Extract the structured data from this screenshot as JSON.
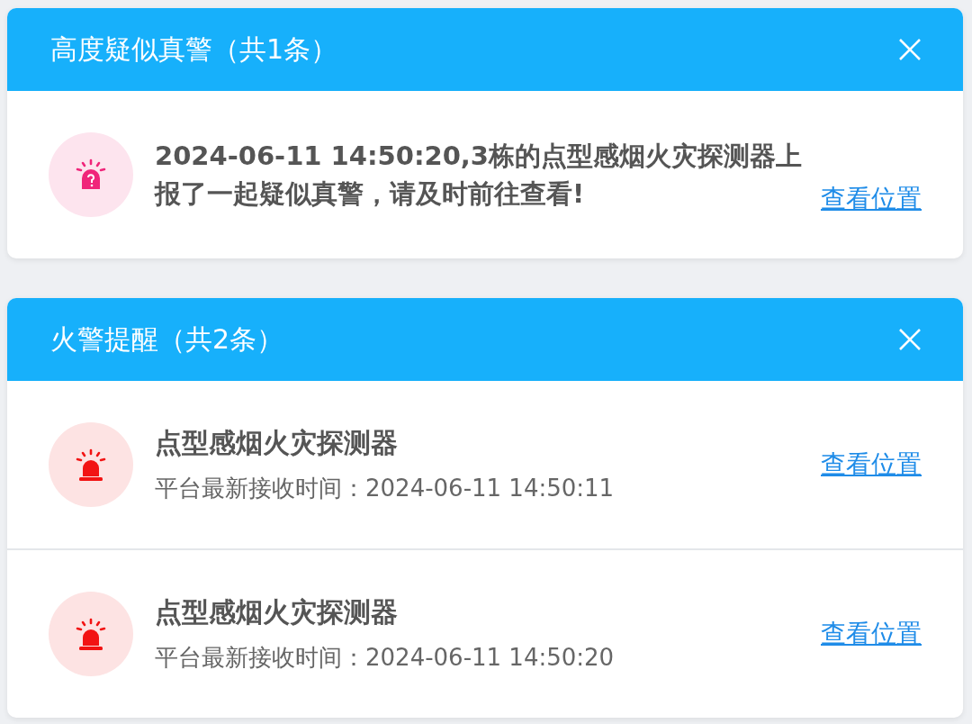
{
  "panels": [
    {
      "title": "高度疑似真警（共1条）",
      "items": [
        {
          "kind": "message",
          "text": "2024-06-11 14:50:20,3栋的点型感烟火灾探测器上报了一起疑似真警，请及时前往查看!",
          "link": "查看位置"
        }
      ]
    },
    {
      "title": "火警提醒（共2条）",
      "items": [
        {
          "kind": "device",
          "name": "点型感烟火灾探测器",
          "time": "平台最新接收时间：2024-06-11 14:50:11",
          "link": "查看位置"
        },
        {
          "kind": "device",
          "name": "点型感烟火灾探测器",
          "time": "平台最新接收时间：2024-06-11 14:50:20",
          "link": "查看位置"
        }
      ]
    }
  ]
}
